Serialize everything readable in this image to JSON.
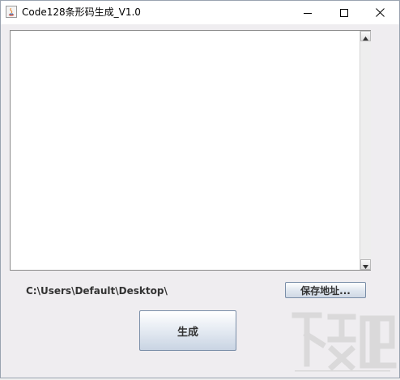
{
  "window": {
    "title": "Code128条形码生成_V1.0",
    "icon": "java-icon"
  },
  "titlebar_controls": {
    "minimize_icon": "minimize-icon",
    "maximize_icon": "maximize-icon",
    "close_icon": "close-icon"
  },
  "main": {
    "text_area_value": "",
    "save_path": "C:\\Users\\Default\\Desktop\\",
    "save_button_label": "保存地址...",
    "generate_button_label": "生成"
  },
  "colors": {
    "window_bg": "#efedf0",
    "button_border": "#7a8ea8"
  }
}
